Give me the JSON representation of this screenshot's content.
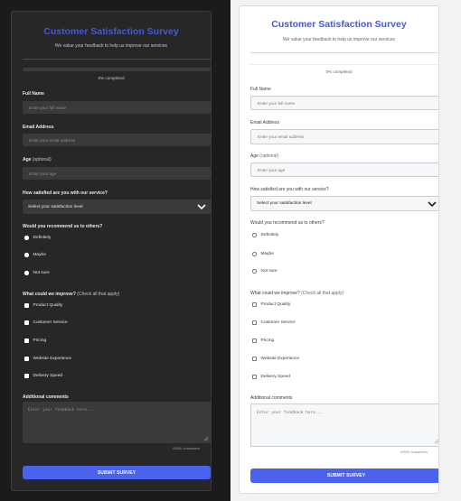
{
  "survey": {
    "title": "Customer Satisfaction Survey",
    "subtitle": "We value your feedback to help us improve our services",
    "progress": 0,
    "progress_text": "0% completed",
    "full_name": {
      "label": "Full Name",
      "placeholder": "Enter your full name"
    },
    "email": {
      "label": "Email Address",
      "placeholder": "Enter your email address"
    },
    "age": {
      "label": "Age",
      "optional": "(optional)",
      "placeholder": "Enter your age"
    },
    "satisfaction": {
      "label": "How satisfied are you with our service?",
      "selected": "Select your satisfaction level"
    },
    "recommend": {
      "label": "Would you recommend us to others?",
      "options": [
        "Definitely",
        "Maybe",
        "Not sure"
      ]
    },
    "improve": {
      "label": "What could we improve?",
      "hint": "(Check all that apply)",
      "options": [
        "Product Quality",
        "Customer Service",
        "Pricing",
        "Website Experience",
        "Delivery Speed"
      ]
    },
    "comments": {
      "label": "Additional comments",
      "placeholder": "Enter your feedback here...",
      "counter": "0/500 characters"
    },
    "submit_label": "SUBMIT SURVEY"
  },
  "colors": {
    "accent": "#4a62ee",
    "title": "#3f58e8",
    "dark_panel": "#272727",
    "light_panel": "#ffffff"
  }
}
